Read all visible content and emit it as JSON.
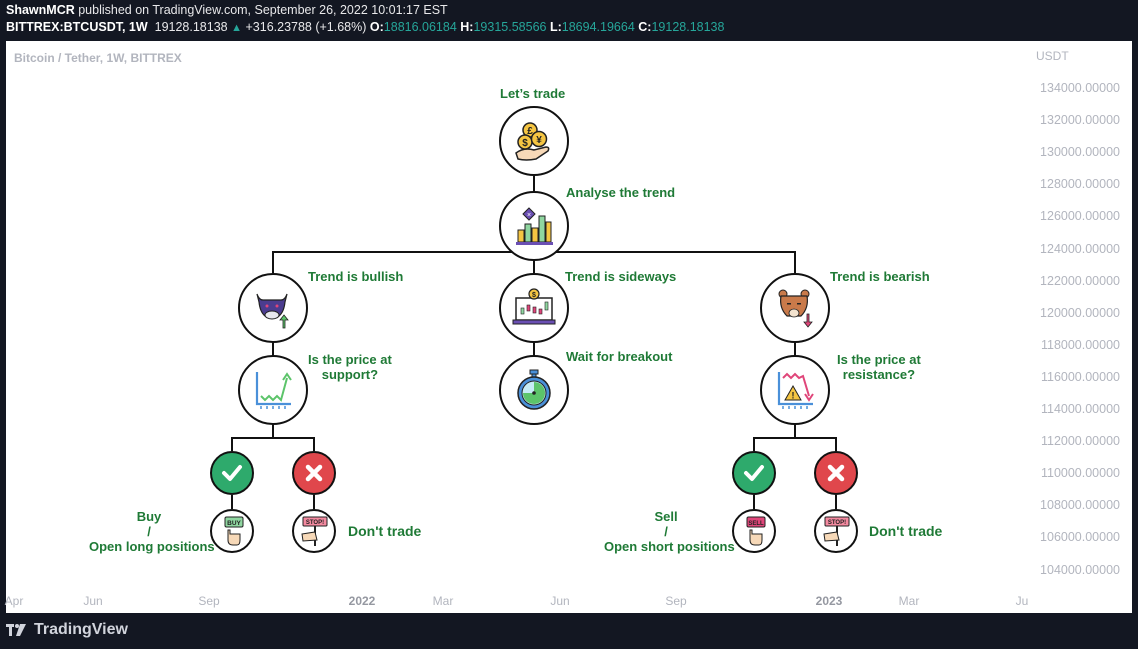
{
  "header": {
    "author": "ShawnMCR",
    "published_text": "published on TradingView.com, September 26, 2022 10:01:17 EST",
    "symbol": "BITTREX:BTCUSDT, 1W",
    "price": "19128.18138",
    "change": "+316.23788 (+1.68%)",
    "ohlc": {
      "o_label": "O:",
      "o": "18816.06184",
      "h_label": "H:",
      "h": "19315.58566",
      "l_label": "L:",
      "l": "18694.19664",
      "c_label": "C:",
      "c": "19128.18138"
    },
    "up_icon": "triangle-up"
  },
  "chart": {
    "title": "Bitcoin / Tether, 1W, BITTREX",
    "y_unit": "USDT",
    "y_ticks": [
      "134000.00000",
      "132000.00000",
      "130000.00000",
      "128000.00000",
      "126000.00000",
      "124000.00000",
      "122000.00000",
      "120000.00000",
      "118000.00000",
      "116000.00000",
      "114000.00000",
      "112000.00000",
      "110000.00000",
      "108000.00000",
      "106000.00000",
      "104000.00000"
    ],
    "x_ticks": [
      {
        "label": "Apr",
        "year": false
      },
      {
        "label": "Jun",
        "year": false
      },
      {
        "label": "Sep",
        "year": false
      },
      {
        "label": "2022",
        "year": true
      },
      {
        "label": "Mar",
        "year": false
      },
      {
        "label": "Jun",
        "year": false
      },
      {
        "label": "Sep",
        "year": false
      },
      {
        "label": "2023",
        "year": true
      },
      {
        "label": "Mar",
        "year": false
      },
      {
        "label": "Ju",
        "year": false
      }
    ]
  },
  "diagram": {
    "start": "Let’s trade",
    "analyse": "Analyse the trend",
    "bullish": "Trend is bullish",
    "sideways": "Trend is sideways",
    "bearish": "Trend is bearish",
    "support_q1": "Is the price at",
    "support_q2": "support?",
    "wait": "Wait for breakout",
    "resistance_q1": "Is the price at",
    "resistance_q2": "resistance?",
    "buy1": "Buy",
    "buy2": "/",
    "buy3": "Open long positions",
    "sell1": "Sell",
    "sell2": "/",
    "sell3": "Open short positions",
    "dont_trade_left": "Don't trade",
    "dont_trade_right": "Don't trade",
    "buy_sign": "BUY",
    "sell_sign": "SELL",
    "stop_sign": "STOP!",
    "label_color": "#1f7a36"
  },
  "footer": {
    "brand": "TradingView"
  }
}
